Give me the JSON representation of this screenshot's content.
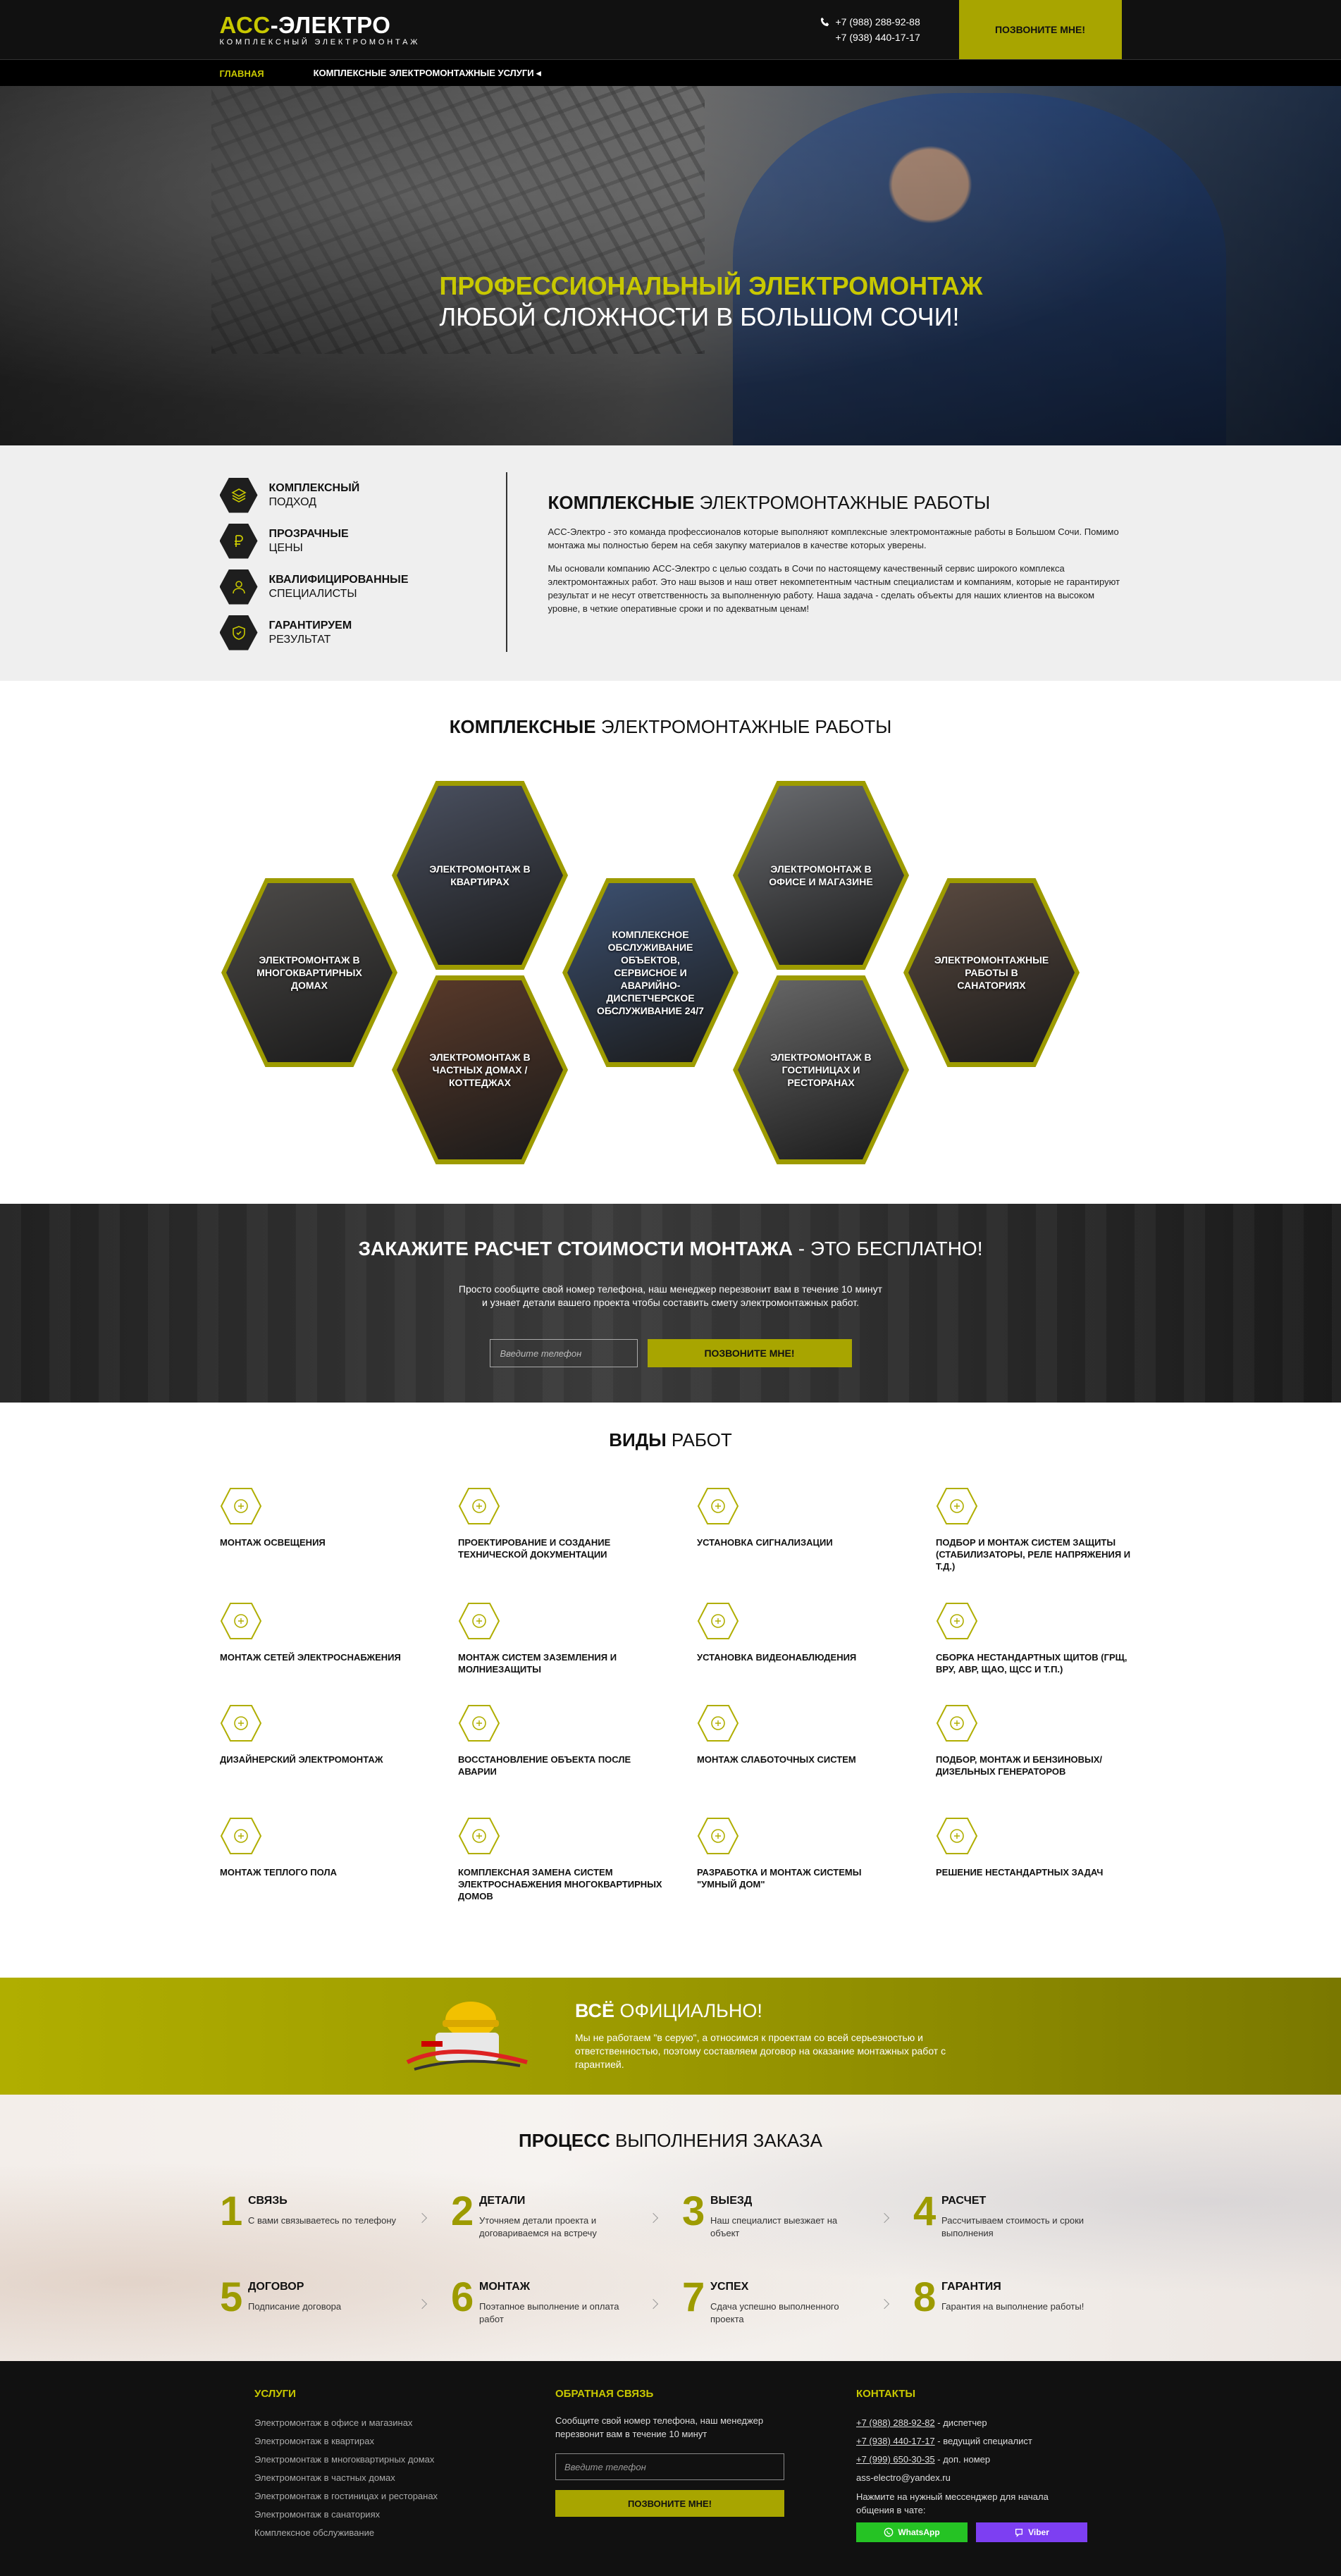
{
  "header": {
    "logo_accent": "АСС",
    "logo_rest": "-ЭЛЕКТРО",
    "logo_sub": "КОМПЛЕКСНЫЙ ЭЛЕКТРОМОНТАЖ",
    "phone1": "+7 (988) 288-92-88",
    "phone2": "+7 (938) 440-17-17",
    "call_label": "ПОЗВОНИТЕ МНЕ!"
  },
  "nav": {
    "items": [
      {
        "label": "ГЛАВНАЯ"
      },
      {
        "label": "КОМПЛЕКСНЫЕ ЭЛЕКТРОМОНТАЖНЫЕ УСЛУГИ ◂"
      }
    ]
  },
  "hero": {
    "line1": "ПРОФЕССИОНАЛЬНЫЙ ЭЛЕКТРОМОНТАЖ",
    "line2": "ЛЮБОЙ СЛОЖНОСТИ В БОЛЬШОМ СОЧИ!"
  },
  "features": [
    {
      "t1": "КОМПЛЕКСНЫЙ",
      "t2": "ПОДХОД",
      "icon": "layers-icon"
    },
    {
      "t1": "ПРОЗРАЧНЫЕ",
      "t2": "ЦЕНЫ",
      "icon": "ruble-icon"
    },
    {
      "t1": "КВАЛИФИЦИРОВАННЫЕ",
      "t2": "СПЕЦИАЛИСТЫ",
      "icon": "worker-icon"
    },
    {
      "t1": "ГАРАНТИРУЕМ",
      "t2": "РЕЗУЛЬТАТ",
      "icon": "shield-icon"
    }
  ],
  "about": {
    "title_bold": "КОМПЛЕКСНЫЕ",
    "title_rest": " ЭЛЕКТРОМОНТАЖНЫЕ РАБОТЫ",
    "p1": "АСС-Электро - это команда профессионалов которые выполняют комплексные электромонтажные работы в Большом Сочи. Помимо монтажа мы полностью берем на себя закупку материалов в качестве которых уверены.",
    "p2": "Мы основали компанию АСС-Электро с целью создать в Сочи по настоящему качественный сервис широкого комплекса электромонтажных работ. Это наш вызов и наш ответ некомпетентным частным специалистам и компаниям, которые не гарантируют результат и не несут ответственность за выполненную работу. Наша задача - сделать объекты для наших клиентов на высоком уровне, в четкие оперативные сроки и по адекватным ценам!"
  },
  "hexsec": {
    "title_bold": "КОМПЛЕКСНЫЕ",
    "title_rest": " ЭЛЕКТРОМОНТАЖНЫЕ РАБОТЫ",
    "items": [
      {
        "label": "ЭЛЕКТРОМОНТАЖ В КВАРТИРАХ",
        "bg": "#4a5060"
      },
      {
        "label": "ЭЛЕКТРОМОНТАЖ В ОФИСЕ И МАГАЗИНЕ",
        "bg": "#6a6c70"
      },
      {
        "label": "ЭЛЕКТРОМОНТАЖ В МНОГОКВАРТИРНЫХ ДОМАХ",
        "bg": "#4c4a48"
      },
      {
        "label": "КОМПЛЕКСНОЕ ОБСЛУЖИВАНИЕ ОБЪЕКТОВ, СЕРВИСНОЕ И АВАРИЙНО-ДИСПЕТЧЕРСКОЕ ОБСЛУЖИВАНИЕ 24/7",
        "bg": "#3c5070"
      },
      {
        "label": "ЭЛЕКТРОМОНТАЖНЫЕ РАБОТЫ В САНАТОРИЯХ",
        "bg": "#5a4a40"
      },
      {
        "label": "ЭЛЕКТРОМОНТАЖ В ЧАСТНЫХ ДОМАХ / КОТТЕДЖАХ",
        "bg": "#5a3a2a"
      },
      {
        "label": "ЭЛЕКТРОМОНТАЖ В ГОСТИНИЦАХ И РЕСТОРАНАХ",
        "bg": "#686868"
      }
    ]
  },
  "order": {
    "title_bold": "ЗАКАЖИТЕ РАСЧЕТ СТОИМОСТИ МОНТАЖА",
    "title_rest": " - ЭТО БЕСПЛАТНО!",
    "text1": "Просто сообщите свой номер телефона, наш менеджер перезвонит вам в течение 10 минут",
    "text2": "и узнает детали вашего проекта чтобы составить смету электромонтажных работ.",
    "placeholder": "Введите телефон",
    "button": "ПОЗВОНИТЕ МНЕ!"
  },
  "services": {
    "title_bold": "ВИДЫ",
    "title_rest": " РАБОТ",
    "items": [
      {
        "label": "МОНТАЖ ОСВЕЩЕНИЯ",
        "icon": "bulb-icon"
      },
      {
        "label": "ПРОЕКТИРОВАНИЕ И СОЗДАНИЕ ТЕХНИЧЕСКОЙ ДОКУМЕНТАЦИИ",
        "icon": "document-icon"
      },
      {
        "label": "УСТАНОВКА СИГНАЛИЗАЦИИ",
        "icon": "antenna-icon"
      },
      {
        "label": "ПОДБОР И МОНТАЖ СИСТЕМ ЗАЩИТЫ (СТАБИЛИЗАТОРЫ, РЕЛЕ НАПРЯЖЕНИЯ И Т.Д.)",
        "icon": "tower-icon"
      },
      {
        "label": "МОНТАЖ СЕТЕЙ ЭЛЕКТРОСНАБЖЕНИЯ",
        "icon": "plug-icon"
      },
      {
        "label": "МОНТАЖ СИСТЕМ ЗАЗЕМЛЕНИЯ И МОЛНИЕЗАЩИТЫ",
        "icon": "lightning-icon"
      },
      {
        "label": "УСТАНОВКА ВИДЕОНАБЛЮДЕНИЯ",
        "icon": "camera-icon"
      },
      {
        "label": "СБОРКА НЕСТАНДАРТНЫХ ЩИТОВ (ГРЩ, ВРУ, АВР, ЩАО, ЩСС И Т.П.)",
        "icon": "panel-icon"
      },
      {
        "label": "ДИЗАЙНЕРСКИЙ ЭЛЕКТРОМОНТАЖ",
        "icon": "tools-icon"
      },
      {
        "label": "ВОССТАНОВЛЕНИЕ ОБЪЕКТА ПОСЛЕ АВАРИИ",
        "icon": "refresh-icon"
      },
      {
        "label": "МОНТАЖ СЛАБОТОЧНЫХ СИСТЕМ",
        "icon": "pylon-icon"
      },
      {
        "label": "ПОДБОР, МОНТАЖ И БЕНЗИНОВЫХ/ДИЗЕЛЬНЫХ ГЕНЕРАТОРОВ",
        "icon": "generator-icon"
      },
      {
        "label": "МОНТАЖ ТЕПЛОГО ПОЛА",
        "icon": "heat-floor-icon"
      },
      {
        "label": "КОМПЛЕКСНАЯ ЗАМЕНА СИСТЕМ ЭЛЕКТРОСНАБЖЕНИЯ МНОГОКВАРТИРНЫХ ДОМОВ",
        "icon": "building-icon"
      },
      {
        "label": "РАЗРАБОТКА И МОНТАЖ СИСТЕМЫ \"УМНЫЙ ДОМ\"",
        "icon": "smart-home-icon"
      },
      {
        "label": "РЕШЕНИЕ НЕСТАНДАРТНЫХ ЗАДАЧ",
        "icon": "tree-icon"
      }
    ]
  },
  "official": {
    "title_bold": "ВСЁ",
    "title_rest": " ОФИЦИАЛЬНО!",
    "text": "Мы не работаем \"в серую\", а относимся к проектам со всей серьезностью и ответственностью, поэтому составляем договор на оказание монтажных работ с гарантией."
  },
  "process": {
    "title_bold": "ПРОЦЕСС",
    "title_rest": " ВЫПОЛНЕНИЯ ЗАКАЗА",
    "steps": [
      {
        "num": "1",
        "title": "СВЯЗЬ",
        "desc": "С вами связываетесь по телефону"
      },
      {
        "num": "2",
        "title": "ДЕТАЛИ",
        "desc": "Уточняем детали проекта и договариваемся на встречу"
      },
      {
        "num": "3",
        "title": "ВЫЕЗД",
        "desc": "Наш специалист выезжает на объект"
      },
      {
        "num": "4",
        "title": "РАСЧЕТ",
        "desc": "Рассчитываем стоимость и сроки выполнения"
      },
      {
        "num": "5",
        "title": "ДОГОВОР",
        "desc": "Подписание договора"
      },
      {
        "num": "6",
        "title": "МОНТАЖ",
        "desc": "Поэтапное выполнение и оплата работ"
      },
      {
        "num": "7",
        "title": "УСПЕХ",
        "desc": "Сдача успешно выполненного проекта"
      },
      {
        "num": "8",
        "title": "ГАРАНТИЯ",
        "desc": "Гарантия на выполнение работы!"
      }
    ]
  },
  "footer": {
    "services_head": "УСЛУГИ",
    "services": [
      "Электромонтаж в офисе и магазинах",
      "Электромонтаж в квартирах",
      "Электромонтаж в многоквартирных домах",
      "Электромонтаж в частных домах",
      "Электромонтаж в гостиницах и ресторанах",
      "Электромонтаж в санаториях",
      "Комплексное обслуживание"
    ],
    "feedback_head": "ОБРАТНАЯ СВЯЗЬ",
    "feedback_text": "Сообщите свой номер телефона, наш менеджер перезвонит вам в течение 10 минут",
    "placeholder": "Введите телефон",
    "button": "ПОЗВОНИТЕ МНЕ!",
    "contacts_head": "КОНТАКТЫ",
    "c1_num": "+7 (988) 288-92-82",
    "c1_role": " - диспетчер",
    "c2_num": "+7 (938) 440-17-17",
    "c2_role": " - ведущий специалист",
    "c3_num": "+7 (999) 650-30-35",
    "c3_role": " - доп. номер",
    "email": "ass-electro@yandex.ru",
    "messenger_text": "Нажмите на нужный мессенджер для начала общения в чате:",
    "whatsapp": "WhatsApp",
    "viber": "Viber",
    "whatsapp_color": "#25c324",
    "viber_color": "#7d3ff2"
  }
}
